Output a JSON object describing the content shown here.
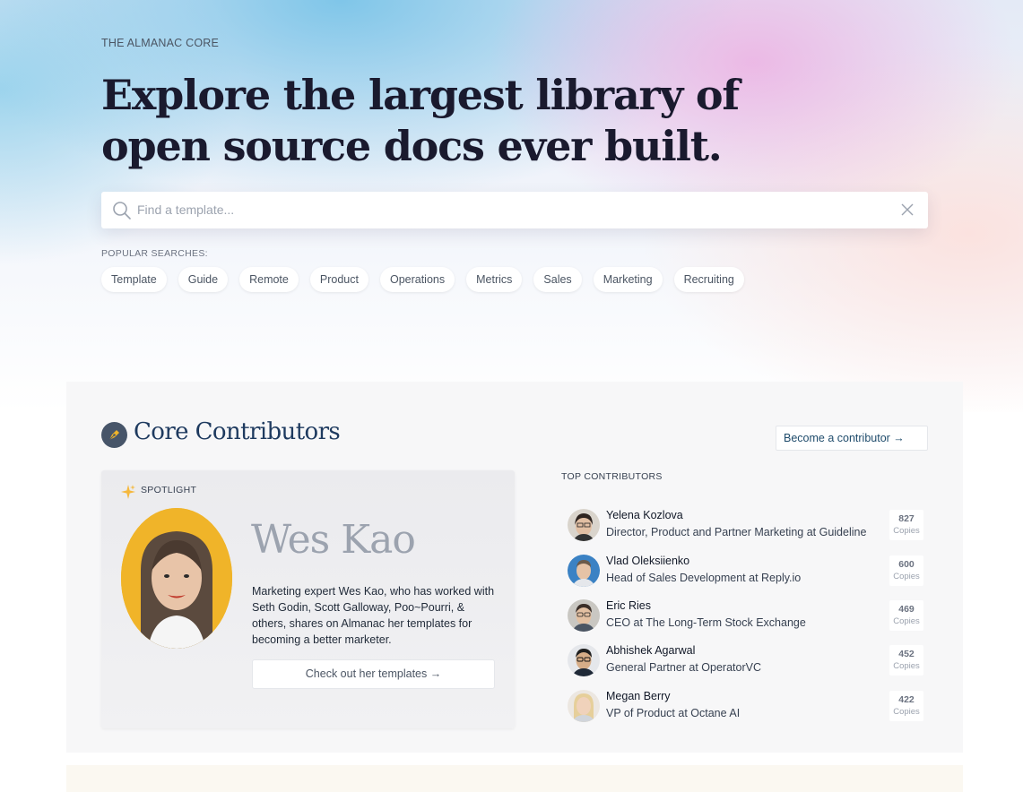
{
  "hero": {
    "eyebrow": "THE ALMANAC CORE",
    "headline": "Explore the largest library of open source docs ever built.",
    "search_placeholder": "Find a template...",
    "popular_label": "POPULAR SEARCHES:",
    "chips": [
      "Template",
      "Guide",
      "Remote",
      "Product",
      "Operations",
      "Metrics",
      "Sales",
      "Marketing",
      "Recruiting"
    ]
  },
  "contributors_section": {
    "title": "Core Contributors",
    "become_button": "Become a contributor →",
    "spotlight": {
      "label": "SPOTLIGHT",
      "name": "Wes Kao",
      "description": "Marketing expert Wes Kao, who has worked with Seth Godin, Scott Galloway, Poo~Pourri, & others, shares on Almanac her templates for becoming a better marketer.",
      "button": "Check out her templates →"
    },
    "top_label": "TOP CONTRIBUTORS",
    "copies_unit": "Copies",
    "top_contributors": [
      {
        "name": "Yelena Kozlova",
        "role": "Director, Product and Partner Marketing at Guideline",
        "copies": "827"
      },
      {
        "name": "Vlad Oleksiienko",
        "role": "Head of Sales Development at Reply.io",
        "copies": "600"
      },
      {
        "name": "Eric Ries",
        "role": "CEO at The Long-Term Stock Exchange",
        "copies": "469"
      },
      {
        "name": "Abhishek Agarwal",
        "role": "General Partner at OperatorVC",
        "copies": "452"
      },
      {
        "name": "Megan Berry",
        "role": "VP of Product at Octane AI",
        "copies": "422"
      }
    ]
  },
  "colors": {
    "headline": "#1a1a2e",
    "section_title": "#1e3a5f",
    "spotlight_bg": "#f0b429",
    "page_section_bg": "#f7f7f8"
  }
}
